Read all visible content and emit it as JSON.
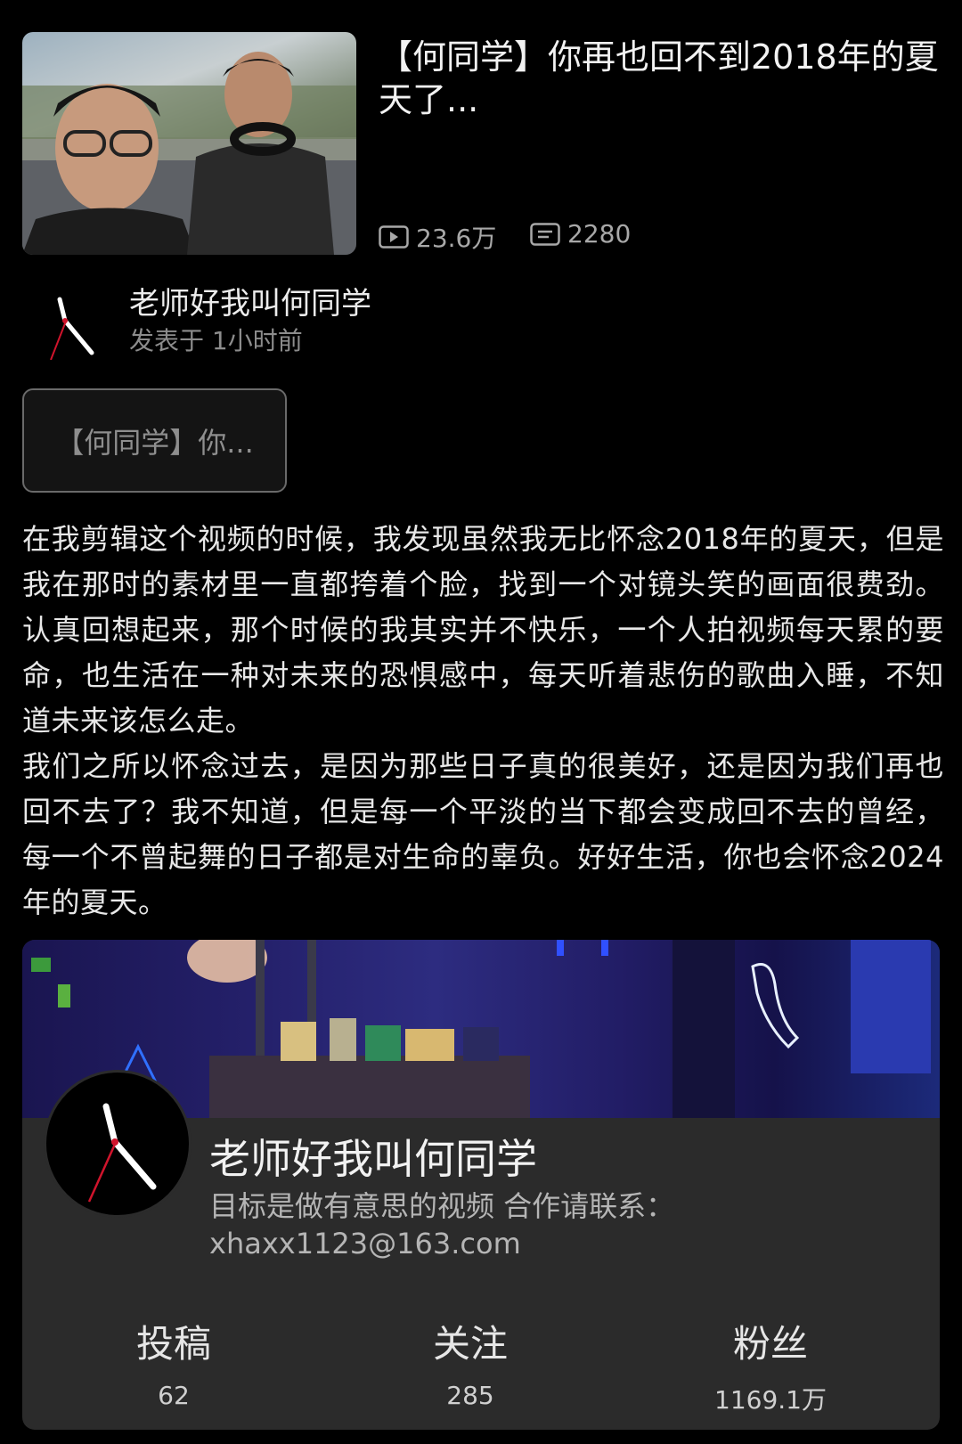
{
  "video": {
    "title": "【何同学】你再也回不到2018年的夏天了...",
    "views": "23.6万",
    "comments": "2280"
  },
  "post": {
    "author": "老师好我叫何同学",
    "time": "发表于 1小时前",
    "link_tag": "【何同学】你...",
    "body_p1": "在我剪辑这个视频的时候，我发现虽然我无比怀念2018年的夏天，但是我在那时的素材里一直都挎着个脸，找到一个对镜头笑的画面很费劲。认真回想起来，那个时候的我其实并不快乐，一个人拍视频每天累的要命，也生活在一种对未来的恐惧感中，每天听着悲伤的歌曲入睡，不知道未来该怎么走。",
    "body_p2": "我们之所以怀念过去，是因为那些日子真的很美好，还是因为我们再也回不去了？我不知道，但是每一个平淡的当下都会变成回不去的曾经，每一个不曾起舞的日子都是对生命的辜负。好好生活，你也会怀念2024年的夏天。"
  },
  "profile": {
    "name": "老师好我叫何同学",
    "bio": "目标是做有意思的视频 合作请联系：xhaxx1123@163.com",
    "metrics": [
      {
        "label": "投稿",
        "value": "62"
      },
      {
        "label": "关注",
        "value": "285"
      },
      {
        "label": "粉丝",
        "value": "1169.1万"
      }
    ]
  },
  "icons": {
    "views": "play-icon",
    "comments": "comment-icon",
    "avatar": "clock-hands-icon"
  }
}
